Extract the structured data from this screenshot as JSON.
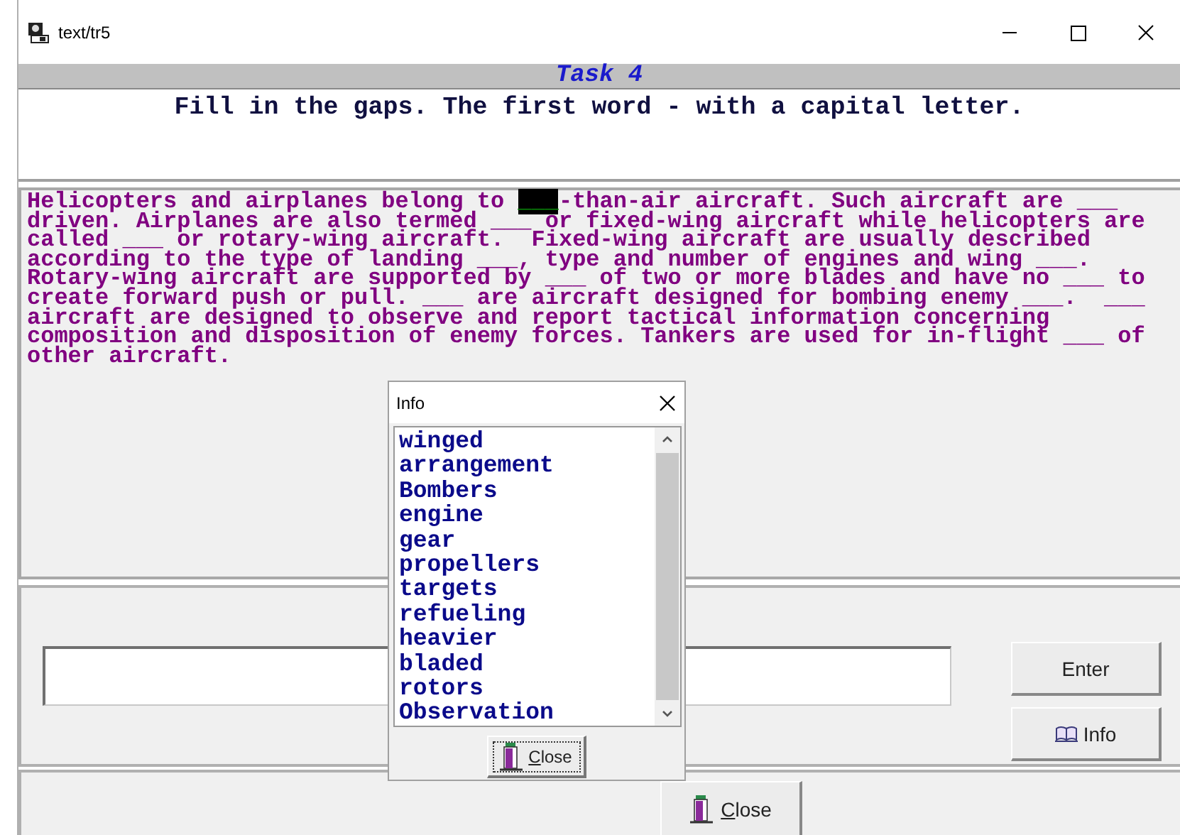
{
  "window": {
    "title": "text/tr5"
  },
  "task": {
    "title": "Task 4",
    "instruction": "Fill in the gaps. The first word - with a capital letter."
  },
  "passage": [
    {
      "kind": "text",
      "text": "Helicopters and airplanes belong to "
    },
    {
      "kind": "gap",
      "text": "___",
      "selected": true
    },
    {
      "kind": "text",
      "text": "-than-air aircraft. Such aircraft are ___\ndriven. Airplanes are also termed ___ or fixed-wing aircraft while helicopters are\ncalled ___ or rotary-wing aircraft.  Fixed-wing aircraft are usually described\naccording to the type of landing ___, type and number of engines and wing ___.\nRotary-wing aircraft are supported by ___ of two or more blades and have no ___ to\ncreate forward push or pull. ___ are aircraft designed for bombing enemy ___.  ___\naircraft are designed to observe and report tactical information concerning\ncomposition and disposition of enemy forces. Tankers are used for in-flight ___ of\nother aircraft."
    }
  ],
  "buttons": [
    {
      "label": "Enter",
      "kind": "plain"
    },
    {
      "label": "Info",
      "kind": "info"
    }
  ],
  "close_button": {
    "label": "Close"
  },
  "info_dialog": {
    "title": "Info",
    "close_button": "Close",
    "items": [
      "winged",
      "arrangement",
      "Bombers",
      "engine",
      "gear",
      "propellers",
      "targets",
      "refueling",
      "heavier",
      "bladed",
      "rotors",
      "Observation"
    ]
  }
}
